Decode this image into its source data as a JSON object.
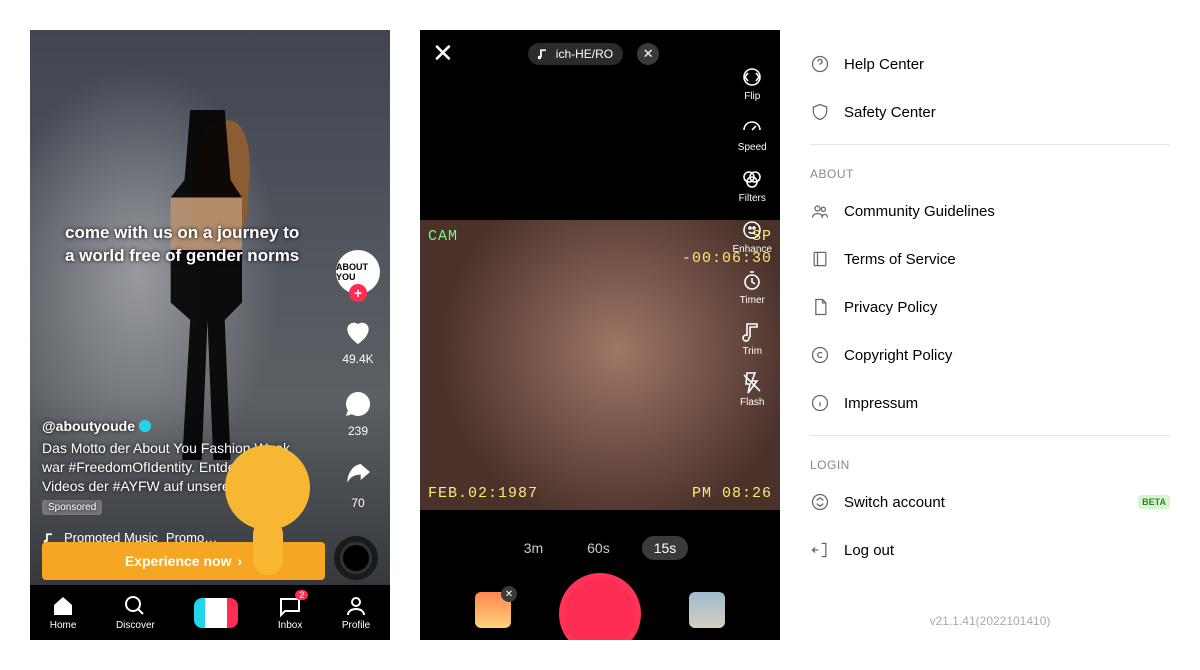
{
  "feed": {
    "top_caption_line1": "come with us on a journey to",
    "top_caption_line2": "a world free of gender norms",
    "avatar_text": "ABOUT YOU",
    "likes": "49.4K",
    "comments": "239",
    "shares": "70",
    "username": "@aboutyoude",
    "description": "Das Motto der About You Fashion Week war #FreedomOfIdentity. Entdecke jetzt Videos der #AYFW auf unserem…",
    "sponsored": "Sponsored",
    "music_label": "Promoted Music",
    "music_extra": "Promo…",
    "cta": "Experience now",
    "nav": {
      "home": "Home",
      "discover": "Discover",
      "inbox": "Inbox",
      "inbox_badge": "2",
      "profile": "Profile"
    }
  },
  "camera": {
    "sound": "ich-HE/RO",
    "overlay": {
      "cam": "CAM",
      "sp": "SP",
      "time": "-00:06:30",
      "date": "FEB.02:1987",
      "clock": "PM 08:26"
    },
    "tools": {
      "flip": "Flip",
      "speed": "Speed",
      "filters": "Filters",
      "enhance": "Enhance",
      "timer": "Timer",
      "trim": "Trim",
      "flash": "Flash"
    },
    "durations": {
      "d1": "3m",
      "d2": "60s",
      "d3": "15s"
    }
  },
  "settings": {
    "help": "Help Center",
    "safety": "Safety Center",
    "about_header": "ABOUT",
    "community": "Community Guidelines",
    "terms": "Terms of Service",
    "privacy": "Privacy Policy",
    "copyright": "Copyright Policy",
    "impressum": "Impressum",
    "login_header": "LOGIN",
    "switch": "Switch account",
    "beta": "BETA",
    "logout": "Log out",
    "version": "v21.1.41(2022101410)"
  }
}
